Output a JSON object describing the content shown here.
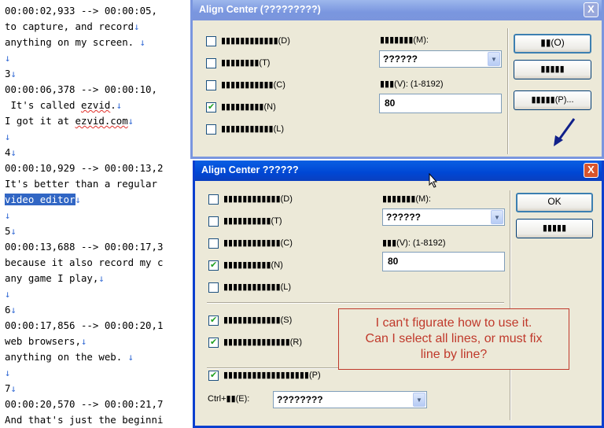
{
  "editor": {
    "lines": [
      {
        "segments": [
          {
            "t": "00:00:02,933 --> 00:00:05,"
          }
        ]
      },
      {
        "segments": [
          {
            "t": "to capture, and record"
          },
          {
            "t": "↓",
            "c": "arrow"
          }
        ]
      },
      {
        "segments": [
          {
            "t": "anything on my screen. "
          },
          {
            "t": "↓",
            "c": "arrow"
          }
        ]
      },
      {
        "segments": [
          {
            "t": "↓",
            "c": "arrow"
          }
        ]
      },
      {
        "segments": [
          {
            "t": "3"
          },
          {
            "t": "↓",
            "c": "arrow"
          }
        ]
      },
      {
        "segments": [
          {
            "t": "00:00:06,378 --> 00:00:10,"
          }
        ]
      },
      {
        "segments": [
          {
            "t": " It's called "
          },
          {
            "t": "ezvid",
            "c": "spell"
          },
          {
            "t": "."
          },
          {
            "t": "↓",
            "c": "arrow"
          }
        ]
      },
      {
        "segments": [
          {
            "t": "I got it at "
          },
          {
            "t": "ezvid.com",
            "c": "spell"
          },
          {
            "t": "↓",
            "c": "arrow"
          }
        ]
      },
      {
        "segments": [
          {
            "t": "↓",
            "c": "arrow"
          }
        ]
      },
      {
        "segments": [
          {
            "t": "4"
          },
          {
            "t": "↓",
            "c": "arrow"
          }
        ]
      },
      {
        "segments": [
          {
            "t": "00:00:10,929 --> 00:00:13,2"
          }
        ]
      },
      {
        "segments": [
          {
            "t": "It's better than a regular"
          }
        ]
      },
      {
        "segments": [
          {
            "t": "video editor",
            "c": "sel"
          },
          {
            "t": "↓",
            "c": "arrow"
          }
        ]
      },
      {
        "segments": [
          {
            "t": "↓",
            "c": "arrow"
          }
        ]
      },
      {
        "segments": [
          {
            "t": "5"
          },
          {
            "t": "↓",
            "c": "arrow"
          }
        ]
      },
      {
        "segments": [
          {
            "t": "00:00:13,688 --> 00:00:17,3"
          }
        ]
      },
      {
        "segments": [
          {
            "t": "because it also record my c"
          }
        ]
      },
      {
        "segments": [
          {
            "t": "any game I play,"
          },
          {
            "t": "↓",
            "c": "arrow"
          }
        ]
      },
      {
        "segments": [
          {
            "t": "↓",
            "c": "arrow"
          }
        ]
      },
      {
        "segments": [
          {
            "t": "6"
          },
          {
            "t": "↓",
            "c": "arrow"
          }
        ]
      },
      {
        "segments": [
          {
            "t": "00:00:17,856 --> 00:00:20,1"
          }
        ]
      },
      {
        "segments": [
          {
            "t": "web browsers,"
          },
          {
            "t": "↓",
            "c": "arrow"
          }
        ]
      },
      {
        "segments": [
          {
            "t": "anything on the web. "
          },
          {
            "t": "↓",
            "c": "arrow"
          }
        ]
      },
      {
        "segments": [
          {
            "t": "↓",
            "c": "arrow"
          }
        ]
      },
      {
        "segments": [
          {
            "t": "7"
          },
          {
            "t": "↓",
            "c": "arrow"
          }
        ]
      },
      {
        "segments": [
          {
            "t": "00:00:20,570 --> 00:00:21,7"
          }
        ]
      },
      {
        "segments": [
          {
            "t": "And that's just the beginni"
          }
        ]
      }
    ]
  },
  "dialog_back": {
    "title": "Align Center (?????????)",
    "close_label": "X",
    "checks": [
      {
        "label": "▮▮▮▮▮▮▮▮▮▮▮▮(D)",
        "checked": false
      },
      {
        "label": "▮▮▮▮▮▮▮▮(T)",
        "checked": false
      },
      {
        "label": "▮▮▮▮▮▮▮▮▮▮▮(C)",
        "checked": false
      },
      {
        "label": "▮▮▮▮▮▮▮▮▮(N)",
        "checked": true
      },
      {
        "label": "▮▮▮▮▮▮▮▮▮▮▮(L)",
        "checked": false
      }
    ],
    "method_label": "▮▮▮▮▮▮▮(M):",
    "method_value": "??????",
    "value_label": "▮▮▮(V): (1-8192)",
    "value": "80",
    "buttons": [
      "▮▮(O)",
      "▮▮▮▮▮",
      "▮▮▮▮▮(P)..."
    ]
  },
  "dialog_front": {
    "title": "Align Center ??????",
    "close_label": "X",
    "checks": [
      {
        "label": "▮▮▮▮▮▮▮▮▮▮▮▮(D)",
        "checked": false
      },
      {
        "label": "▮▮▮▮▮▮▮▮▮▮(T)",
        "checked": false
      },
      {
        "label": "▮▮▮▮▮▮▮▮▮▮▮▮(C)",
        "checked": false
      },
      {
        "label": "▮▮▮▮▮▮▮▮▮▮(N)",
        "checked": true
      },
      {
        "label": "▮▮▮▮▮▮▮▮▮▮▮▮(L)",
        "checked": false
      }
    ],
    "checks2": [
      {
        "label": "▮▮▮▮▮▮▮▮▮▮▮▮(S)",
        "checked": true
      },
      {
        "label": "▮▮▮▮▮▮▮▮▮▮▮▮▮▮(R)",
        "checked": true
      }
    ],
    "check3": {
      "label": "▮▮▮▮▮▮▮▮▮▮▮▮▮▮▮▮▮▮(P)",
      "checked": true
    },
    "method_label": "▮▮▮▮▮▮▮(M):",
    "method_value": "??????",
    "value_label": "▮▮▮(V): (1-8192)",
    "value": "80",
    "ok_label": "OK",
    "cancel_label": "▮▮▮▮▮",
    "hotkey_label": "Ctrl+▮▮(E):",
    "hotkey_value": "????????"
  },
  "annotation": {
    "lines": [
      "I can't figurate how to use it.",
      "Can I select all lines, or must fix",
      "line by line?"
    ]
  },
  "colors": {
    "title_active": "#0a5fe3",
    "title_inactive": "#7a96df",
    "selection": "#3166c4",
    "annotation": "#c0392b",
    "eol_arrow": "#3a6fd6"
  },
  "icons": {
    "close": "close-icon",
    "dropdown": "chevron-down-icon",
    "cursor": "mouse-pointer-icon",
    "pointer_arrow": "blue-arrow-icon"
  }
}
